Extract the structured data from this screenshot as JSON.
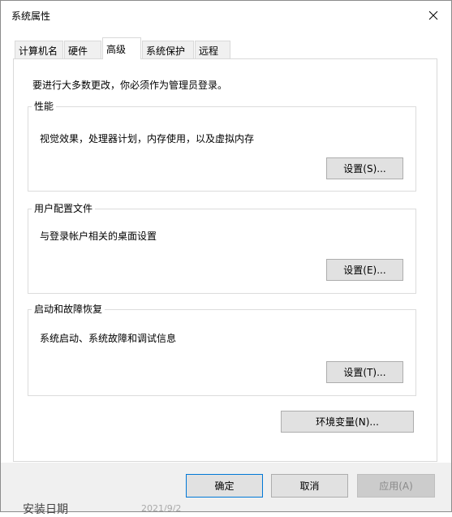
{
  "window": {
    "title": "系统属性"
  },
  "tabs": [
    {
      "label": "计算机名"
    },
    {
      "label": "硬件"
    },
    {
      "label": "高级"
    },
    {
      "label": "系统保护"
    },
    {
      "label": "远程"
    }
  ],
  "active_tab": "高级",
  "admin_note": "要进行大多数更改，你必须作为管理员登录。",
  "groups": {
    "performance": {
      "title": "性能",
      "description": "视觉效果，处理器计划，内存使用，以及虚拟内存",
      "button": "设置(S)..."
    },
    "user_profiles": {
      "title": "用户配置文件",
      "description": "与登录帐户相关的桌面设置",
      "button": "设置(E)..."
    },
    "startup_recovery": {
      "title": "启动和故障恢复",
      "description": "系统启动、系统故障和调试信息",
      "button": "设置(T)..."
    }
  },
  "env_button": "环境变量(N)...",
  "footer": {
    "ok": "确定",
    "cancel": "取消",
    "apply": "应用(A)"
  },
  "background_window": {
    "label": "安装日期",
    "date": "2021/9/2"
  },
  "colors": {
    "focus_border": "#0078d7",
    "disabled_text": "#8a8a8a"
  },
  "icons": {
    "close": "close-icon"
  }
}
